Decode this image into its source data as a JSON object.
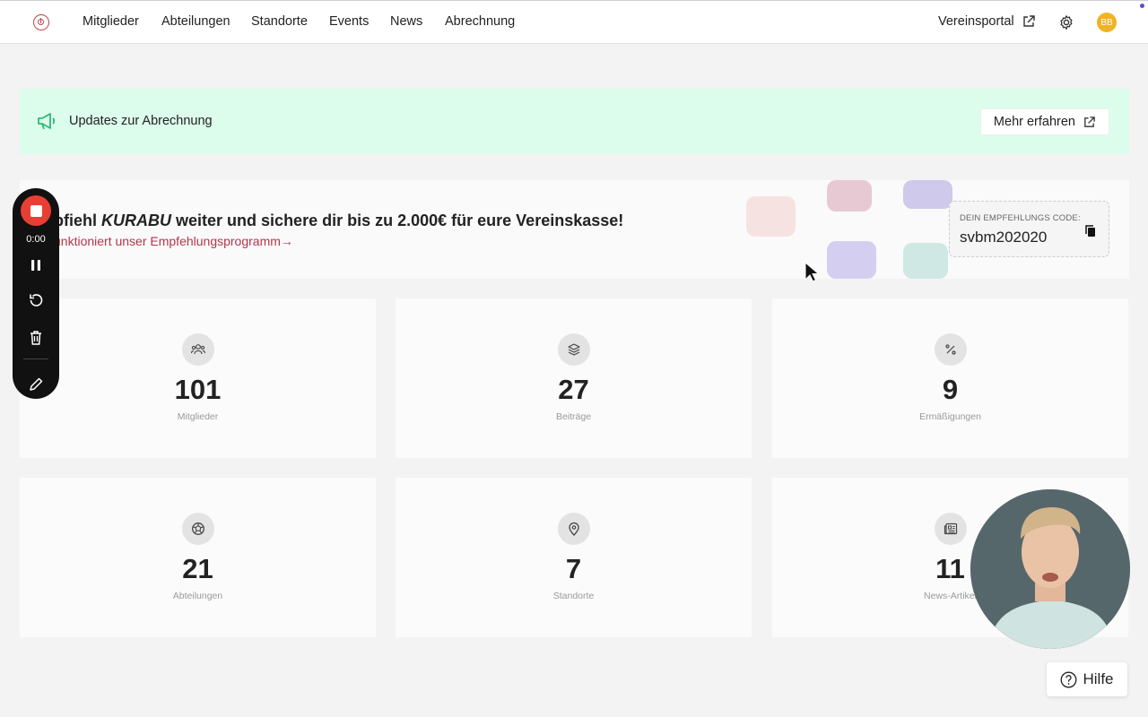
{
  "nav": {
    "items": [
      {
        "label": "Mitglieder"
      },
      {
        "label": "Abteilungen"
      },
      {
        "label": "Standorte"
      },
      {
        "label": "Events"
      },
      {
        "label": "News"
      },
      {
        "label": "Abrechnung"
      }
    ],
    "portal_label": "Vereinsportal",
    "avatar_initials": "BB"
  },
  "banner": {
    "text": "Updates zur Abrechnung",
    "button_label": "Mehr erfahren",
    "bg_color": "#dcfcec",
    "icon_color": "#2fb872"
  },
  "referral": {
    "title_prefix": "pfiehl",
    "title_brand": "KURABU",
    "title_suffix": "weiter und sichere dir bis zu 2.000€ für eure Vereinskasse!",
    "link_text": "unktioniert unser Empfehlungsprogramm→",
    "code_label": "DEIN EMPFEHLUNGS CODE:",
    "code_value": "svbm202020",
    "link_color": "#b5354a"
  },
  "stats": [
    {
      "value": "101",
      "label": "Mitglieder",
      "icon": "people-icon"
    },
    {
      "value": "27",
      "label": "Beiträge",
      "icon": "layers-icon"
    },
    {
      "value": "9",
      "label": "Ermäßigungen",
      "icon": "percent-icon"
    },
    {
      "value": "21",
      "label": "Abteilungen",
      "icon": "ball-icon"
    },
    {
      "value": "7",
      "label": "Standorte",
      "icon": "location-pin-icon"
    },
    {
      "value": "11",
      "label": "News-Artikel",
      "icon": "newspaper-icon"
    }
  ],
  "recorder": {
    "time": "0:00",
    "stop_color": "#e64034"
  },
  "help": {
    "label": "Hilfe"
  }
}
